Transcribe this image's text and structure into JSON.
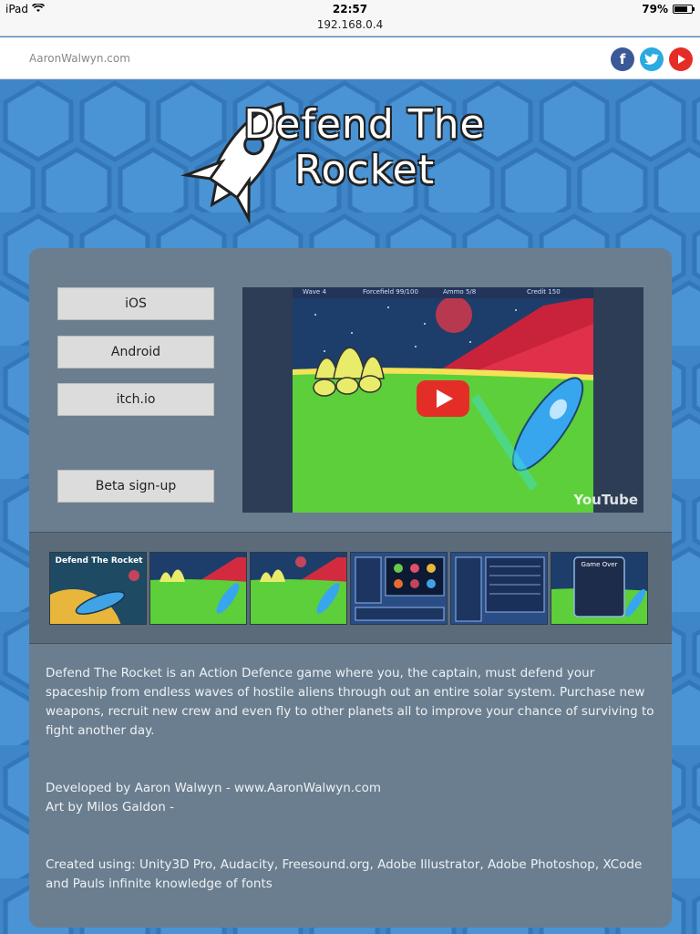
{
  "status_bar": {
    "device": "iPad",
    "time": "22:57",
    "battery": "79%",
    "battery_level": 0.79
  },
  "url_bar": {
    "address": "192.168.0.4"
  },
  "site_header": {
    "site_name": "AaronWalwyn.com",
    "social": [
      {
        "name": "facebook",
        "glyph": "f",
        "color": "#3b5998"
      },
      {
        "name": "twitter",
        "glyph": "t",
        "color": "#2ba9e1"
      },
      {
        "name": "youtube",
        "glyph": "▶",
        "color": "#e52d27"
      }
    ]
  },
  "logo": {
    "title_line1": "Defend The",
    "title_line2": "Rocket"
  },
  "buttons": {
    "ios": "iOS",
    "android": "Android",
    "itchio": "itch.io",
    "beta": "Beta sign-up"
  },
  "video": {
    "hud": {
      "wave": "Wave",
      "wave_value": "4",
      "forcefield": "Forcefield",
      "forcefield_value": "99/100",
      "ammo": "Ammo",
      "ammo_value": "5/8",
      "credit": "Credit",
      "credit_value": "150"
    },
    "youtube_label": "YouTube"
  },
  "thumbnails": [
    {
      "name": "thumb-title",
      "caption": "Defend The Rocket"
    },
    {
      "name": "thumb-gameplay-1",
      "caption": ""
    },
    {
      "name": "thumb-gameplay-2",
      "caption": ""
    },
    {
      "name": "thumb-planet-select",
      "caption": ""
    },
    {
      "name": "thumb-shop",
      "caption": ""
    },
    {
      "name": "thumb-game-over",
      "caption": "Game Over"
    }
  ],
  "description": {
    "paragraph1": "Defend The Rocket is an Action Defence game where you, the captain, must defend your spaceship from endless waves of hostile aliens through out an entire solar system. Purchase new weapons, recruit new crew and even fly to other planets all to improve your chance of surviving to fight another day.",
    "developer": "Developed by Aaron Walwyn - www.AaronWalwyn.com",
    "art": "Art by Milos Galdon -",
    "tools": "Created using: Unity3D Pro, Audacity, Freesound.org, Adobe Illustrator, Adobe Photoshop, XCode and Pauls infinite knowledge of fonts"
  },
  "colors": {
    "background": "#3f86c9",
    "panel": "#6b7e8f",
    "button": "#dcdcdc"
  }
}
